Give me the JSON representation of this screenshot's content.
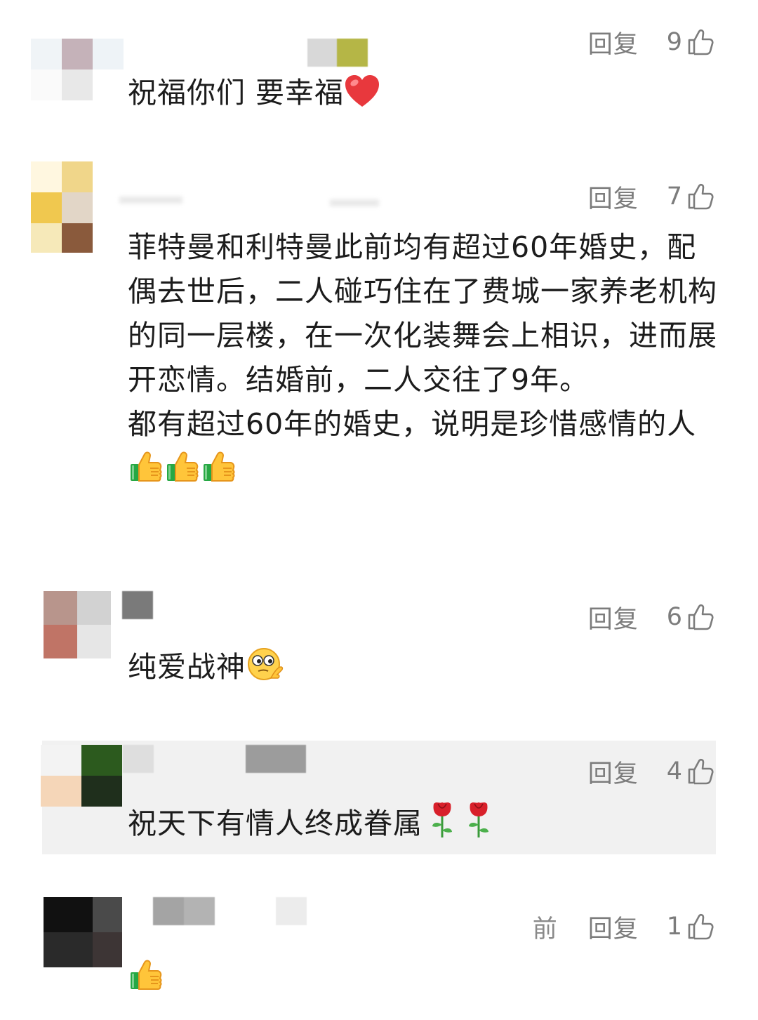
{
  "comments": [
    {
      "reply_label": "回复",
      "likes": "9",
      "text": "祝福你们 要幸福",
      "emoji": "heart-emoji",
      "highlighted": false
    },
    {
      "reply_label": "回复",
      "likes": "7",
      "text": "菲特曼和利特曼此前均有超过60年婚史，配偶去世后，二人碰巧住在了费城一家养老机构的同一层楼，在一次化装舞会上相识，进而展开恋情。结婚前，二人交往了9年。\n都有超过60年的婚史，说明是珍惜感情的人",
      "emoji": "thumbs-up-emoji x3",
      "highlighted": false
    },
    {
      "reply_label": "回复",
      "likes": "6",
      "text": "纯爱战神",
      "emoji": "thinking-face-emoji",
      "highlighted": false
    },
    {
      "reply_label": "回复",
      "likes": "4",
      "text": "祝天下有情人终成眷属",
      "emoji": "rose-emoji x2",
      "highlighted": true
    },
    {
      "time_fragment": "前",
      "reply_label": "回复",
      "likes": "1",
      "text": "",
      "emoji": "thumbs-up-emoji",
      "highlighted": false
    }
  ],
  "colors": {
    "action_text": "#7c7c7c",
    "body_text": "#1c1c1c",
    "highlight_bg": "#f1f1f1"
  }
}
